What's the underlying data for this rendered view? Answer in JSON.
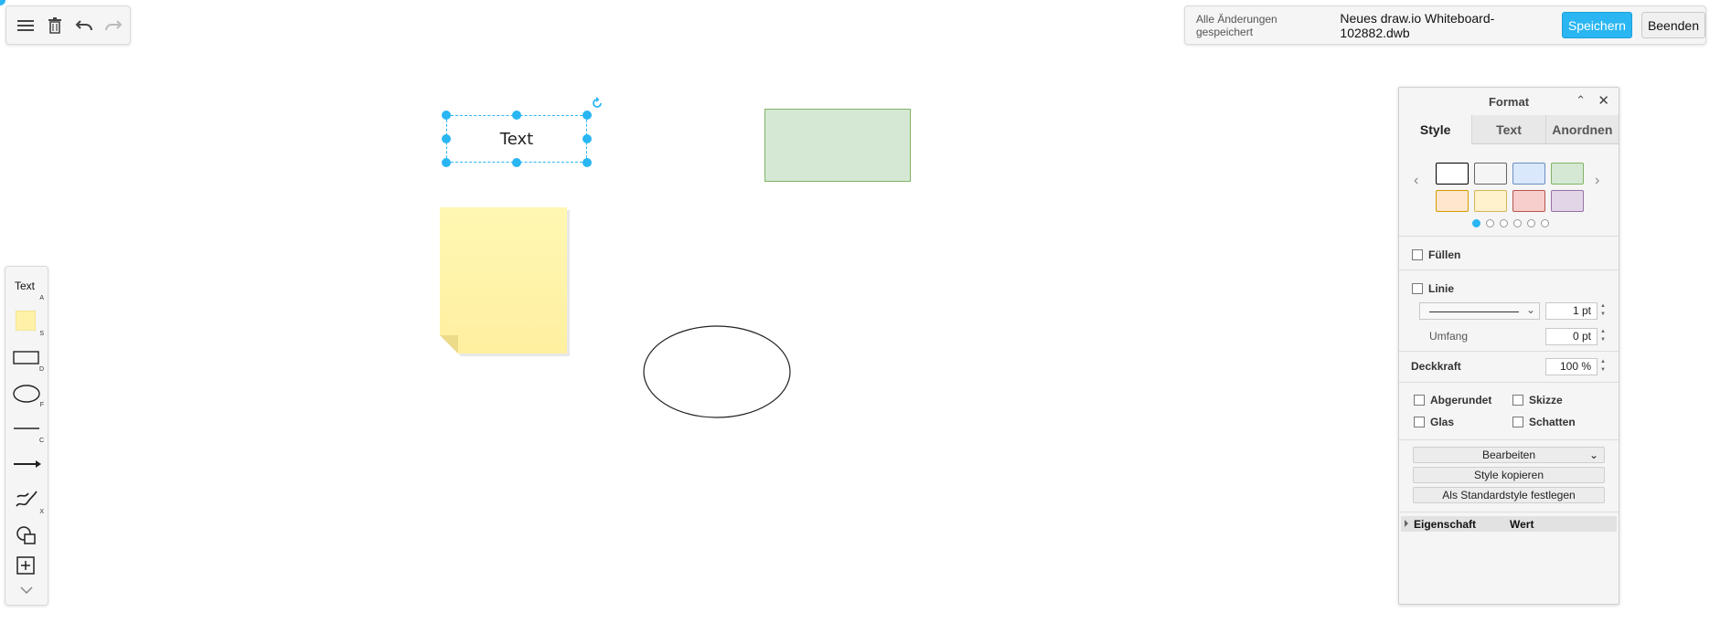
{
  "toolbar_left": {
    "icons": [
      "menu-icon",
      "trash-icon",
      "undo-icon",
      "redo-icon"
    ]
  },
  "header": {
    "save_status": "Alle Änderungen gespeichert",
    "file_name": "Neues draw.io Whiteboard-102882.dwb",
    "save_label": "Speichern",
    "exit_label": "Beenden"
  },
  "left_tools": {
    "text_label": "Text",
    "text_shortcut": "A",
    "sticky_shortcut": "S",
    "rectangle_shortcut": "D",
    "ellipse_shortcut": "F",
    "line_shortcut": "C",
    "freehand_shortcut": "X"
  },
  "canvas": {
    "text_shape_label": "Text"
  },
  "format_panel": {
    "title": "Format",
    "tabs": [
      "Style",
      "Text",
      "Anordnen"
    ],
    "swatch_colors": [
      {
        "fill": "#ffffff",
        "stroke": "#000000"
      },
      {
        "fill": "#f5f5f5",
        "stroke": "#666666"
      },
      {
        "fill": "#dae8fc",
        "stroke": "#6c8ebf"
      },
      {
        "fill": "#d5e8d4",
        "stroke": "#82b366"
      },
      {
        "fill": "#ffe6cc",
        "stroke": "#d79b00"
      },
      {
        "fill": "#fff2cc",
        "stroke": "#d6b656"
      },
      {
        "fill": "#f8cecc",
        "stroke": "#b85450"
      },
      {
        "fill": "#e1d5e7",
        "stroke": "#9673a6"
      }
    ],
    "fill_label": "Füllen",
    "line_label": "Linie",
    "line_width": "1 pt",
    "perimeter_label": "Umfang",
    "perimeter_value": "0 pt",
    "opacity_label": "Deckkraft",
    "opacity_value": "100 %",
    "rounded_label": "Abgerundet",
    "sketch_label": "Skizze",
    "glass_label": "Glas",
    "shadow_label": "Schatten",
    "edit_label": "Bearbeiten",
    "copy_style_label": "Style kopieren",
    "set_default_label": "Als Standardstyle festlegen",
    "property_col": "Eigenschaft",
    "value_col": "Wert"
  },
  "colors": {
    "accent": "#29b6f2",
    "sticky_fill": "#fff2a8",
    "green_fill": "#d5e8d4",
    "green_stroke": "#82b366"
  }
}
